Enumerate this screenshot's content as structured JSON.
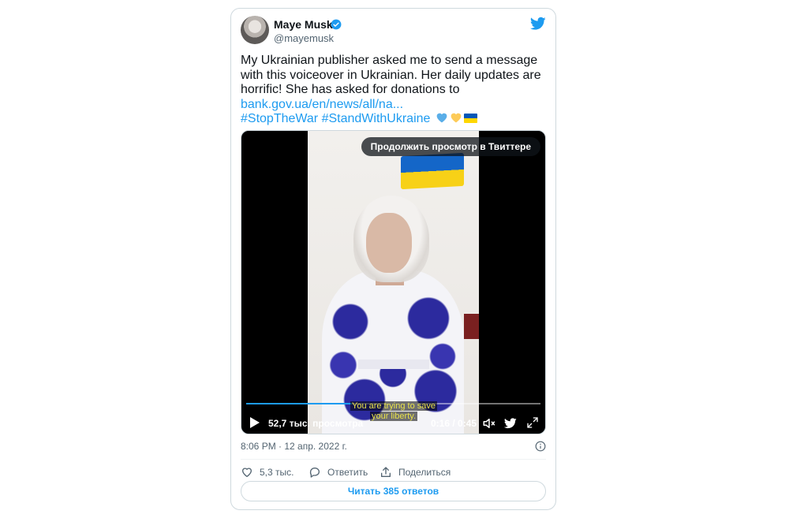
{
  "author": {
    "name": "Maye Musk",
    "handle": "@mayemusk",
    "verified": true
  },
  "tweet": {
    "text_lines": [
      "My Ukrainian publisher asked me to send a message",
      "with this voiceover in Ukrainian. Her daily updates are",
      "horrific! She has asked for donations to"
    ],
    "link": "bank.gov.ua/en/news/all/na...",
    "hashtag_1": "#StopTheWar",
    "hashtag_2": "#StandWithUkraine"
  },
  "video": {
    "cta": "Продолжить просмотр в Твиттере",
    "subtitle_line_1": "You are trying to save",
    "subtitle_line_2": "your liberty.",
    "views": "52,7 тыс. просмотра",
    "time": "0:16 / 0:45",
    "progress_fraction": 0.36
  },
  "meta": {
    "timestamp": "8:06 PM · 12 апр. 2022 г."
  },
  "actions": {
    "like_count": "5,3 тыс.",
    "reply_label": "Ответить",
    "share_label": "Поделиться"
  },
  "read_replies": "Читать 385 ответов",
  "colors": {
    "accent": "#1d9bf0",
    "text": "#0f1419",
    "muted": "#536471",
    "border": "#cfd9de"
  }
}
